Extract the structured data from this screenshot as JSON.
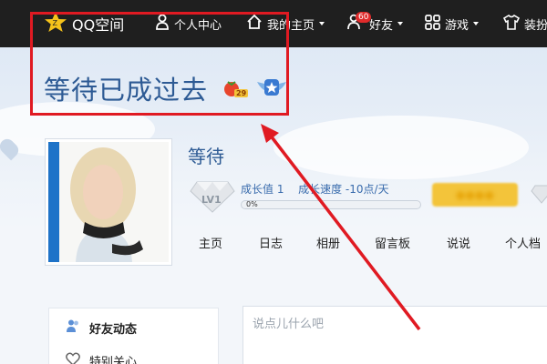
{
  "nav": {
    "logo_label": "QQ空间",
    "items": [
      {
        "label": "个人中心",
        "icon": "person-icon"
      },
      {
        "label": "我的主页",
        "icon": "home-icon"
      },
      {
        "label": "好友",
        "icon": "friends-icon",
        "badge": "60"
      },
      {
        "label": "游戏",
        "icon": "grid-icon"
      },
      {
        "label": "装扮",
        "icon": "tshirt-icon"
      }
    ]
  },
  "space": {
    "title": "等待已成过去",
    "fruit_level": "29"
  },
  "profile": {
    "username": "等待",
    "level_label": "LV1",
    "growth_value": "成长值 1",
    "growth_speed": "成长速度 -10点/天",
    "progress_text": "0%",
    "progress": 0
  },
  "tabs": [
    "主页",
    "日志",
    "相册",
    "留言板",
    "说说",
    "个人档"
  ],
  "sidebar": {
    "items": [
      {
        "label": "好友动态",
        "icon": "friends-feed-icon"
      },
      {
        "label": "特别关心",
        "icon": "heart-icon"
      }
    ]
  },
  "composer": {
    "placeholder": "说点儿什么吧"
  },
  "colors": {
    "nav_bg": "#1f1f1f",
    "title_blue": "#2d5a94",
    "highlight_red": "#e01a22"
  }
}
